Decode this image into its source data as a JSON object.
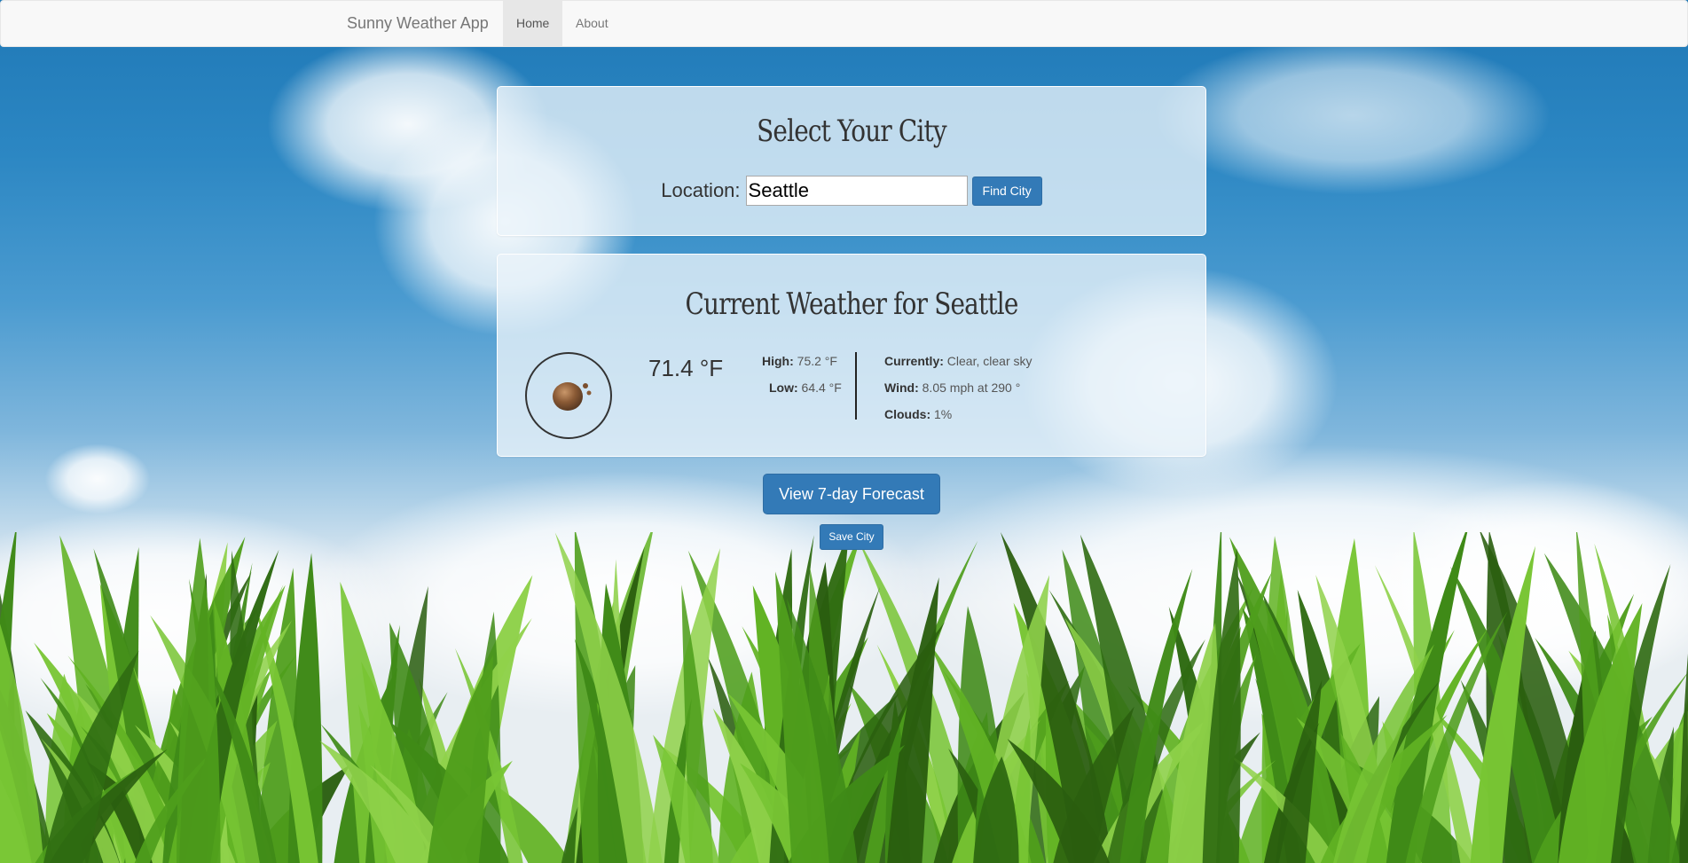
{
  "navbar": {
    "brand": "Sunny Weather App",
    "items": [
      {
        "label": "Home",
        "active": true
      },
      {
        "label": "About",
        "active": false
      }
    ]
  },
  "city_panel": {
    "title": "Select Your City",
    "location_label": "Location:",
    "location_value": "Seattle",
    "find_button": "Find City"
  },
  "weather_panel": {
    "title": "Current Weather for Seattle",
    "icon": "dust-weather-icon",
    "temperature": "71.4 °F",
    "high_label": "High:",
    "high_value": "75.2 °F",
    "low_label": "Low:",
    "low_value": "64.4 °F",
    "currently_label": "Currently:",
    "currently_value": "Clear, clear sky",
    "wind_label": "Wind:",
    "wind_value": "8.05 mph at 290 °",
    "clouds_label": "Clouds:",
    "clouds_value": "1%"
  },
  "actions": {
    "forecast_button": "View 7-day Forecast",
    "save_button": "Save City"
  },
  "colors": {
    "primary_button": "#337ab7",
    "navbar_bg": "#f8f8f8",
    "sky": "#2c87c3"
  }
}
